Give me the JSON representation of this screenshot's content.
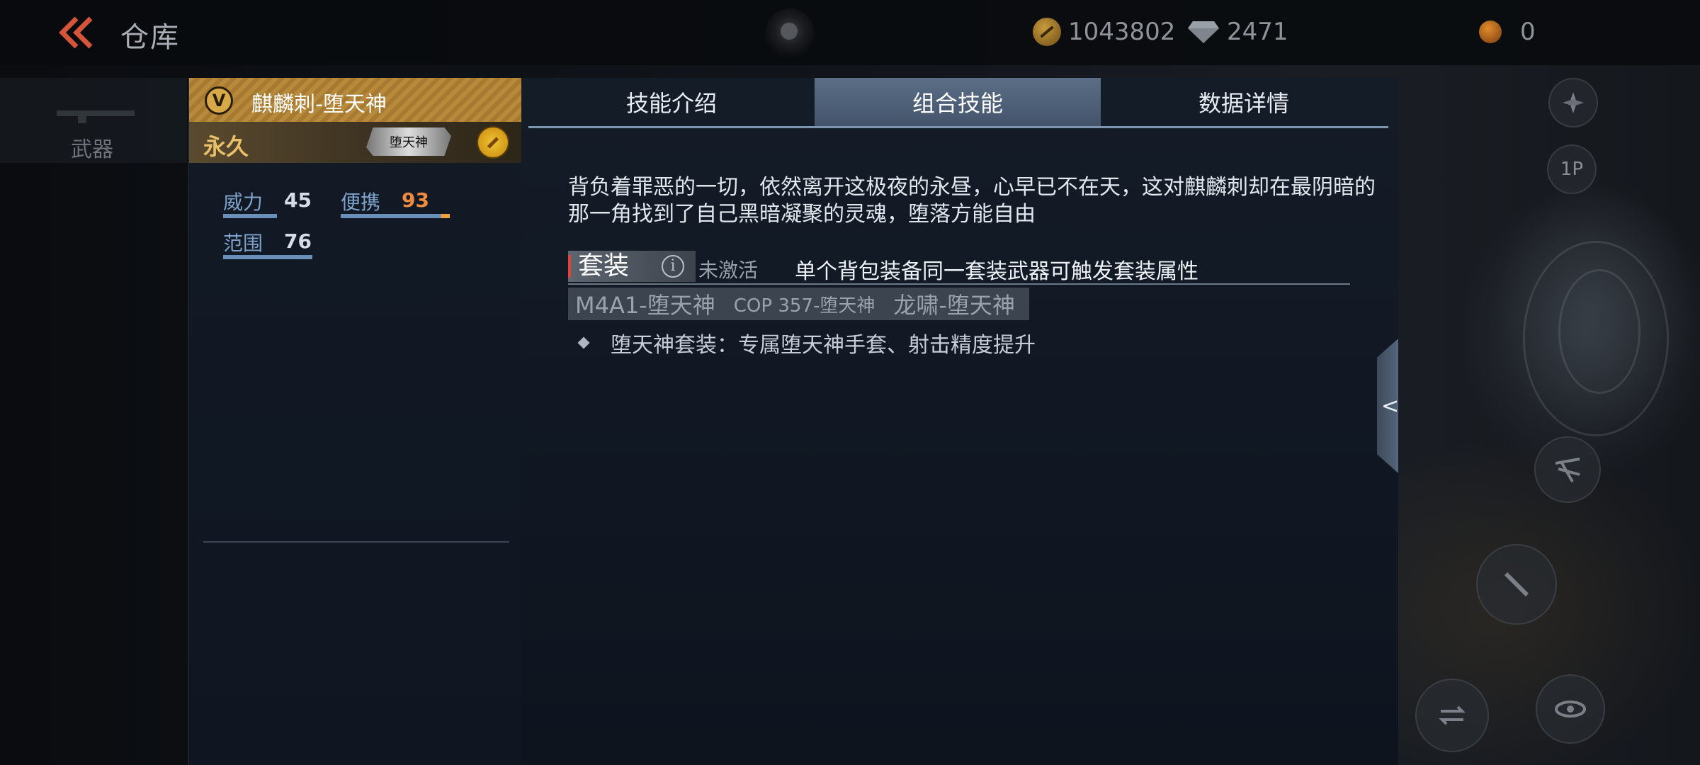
{
  "header": {
    "title": "仓库",
    "gold": "1043802",
    "diamonds": "2471",
    "tokens": "0"
  },
  "nav": {
    "weapons_label": "武器"
  },
  "weapon": {
    "name": "麒麟刺-堕天神",
    "badge": "V",
    "duration": "永久",
    "skin_tag": "堕天神",
    "stats": [
      {
        "label": "威力",
        "value": "45"
      },
      {
        "label": "便携",
        "value": "93"
      },
      {
        "label": "范围",
        "value": "76"
      }
    ]
  },
  "tabs": [
    {
      "label": "技能介绍"
    },
    {
      "label": "组合技能"
    },
    {
      "label": "数据详情"
    }
  ],
  "active_tab": "组合技能",
  "skill": {
    "description": "背负着罪恶的一切，依然离开这极夜的永昼，心早已不在天，这对麒麟刺却在最阴暗的那一角找到了自己黑暗凝聚的灵魂，堕落方能自由",
    "set_label": "套装",
    "set_status": "未激活",
    "set_rule": "单个背包装备同一套装武器可触发套装属性",
    "set_weapons": [
      "M4A1-堕天神",
      "COP 357-堕天神",
      "龙啸-堕天神"
    ],
    "bonus": "堕天神套装：专属堕天神手套、射击精度提升"
  },
  "side_buttons": {
    "player_mode": "1P"
  },
  "colors": {
    "accent_gold": "#d7a948",
    "stat_blue": "#7ea2c9",
    "highlight_orange": "#f08a3c",
    "active_tab": "#4f6179"
  },
  "icons": [
    "back-chevron-icon",
    "gold-coin-icon",
    "diamond-icon",
    "token-icon",
    "rank-v-icon",
    "medal-icon",
    "info-icon",
    "collapse-chevron-icon"
  ]
}
